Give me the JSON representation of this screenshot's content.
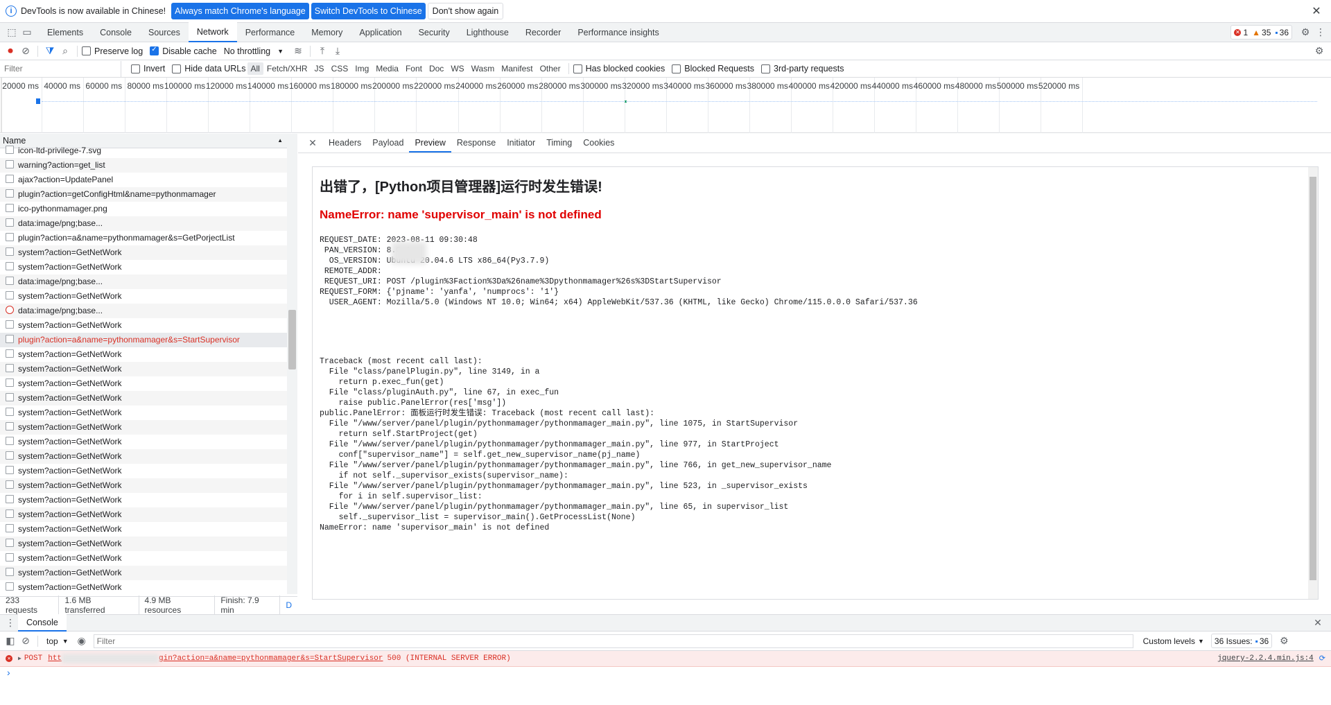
{
  "infobar": {
    "message": "DevTools is now available in Chinese!",
    "btn_match": "Always match Chrome's language",
    "btn_switch": "Switch DevTools to Chinese",
    "btn_dont": "Don't show again"
  },
  "tabs": [
    "Elements",
    "Console",
    "Sources",
    "Network",
    "Performance",
    "Memory",
    "Application",
    "Security",
    "Lighthouse",
    "Recorder",
    "Performance insights"
  ],
  "counts": {
    "errors": "1",
    "warnings": "35",
    "messages": "36"
  },
  "toolbar": {
    "preserve_log": "Preserve log",
    "disable_cache": "Disable cache",
    "throttling": "No throttling"
  },
  "filterbar": {
    "placeholder": "Filter",
    "invert": "Invert",
    "hide_data_urls": "Hide data URLs",
    "types": [
      "All",
      "Fetch/XHR",
      "JS",
      "CSS",
      "Img",
      "Media",
      "Font",
      "Doc",
      "WS",
      "Wasm",
      "Manifest",
      "Other"
    ],
    "blocked_cookies": "Has blocked cookies",
    "blocked_requests": "Blocked Requests",
    "third_party": "3rd-party requests"
  },
  "overview_ticks": [
    "20000 ms",
    "40000 ms",
    "60000 ms",
    "80000 ms",
    "100000 ms",
    "120000 ms",
    "140000 ms",
    "160000 ms",
    "180000 ms",
    "200000 ms",
    "220000 ms",
    "240000 ms",
    "260000 ms",
    "280000 ms",
    "300000 ms",
    "320000 ms",
    "340000 ms",
    "360000 ms",
    "380000 ms",
    "400000 ms",
    "420000 ms",
    "440000 ms",
    "460000 ms",
    "480000 ms",
    "500000 ms",
    "520000 ms"
  ],
  "requests": {
    "header": "Name",
    "rows": [
      "icon-ltd-privilege-7.svg",
      "warning?action=get_list",
      "ajax?action=UpdatePanel",
      "plugin?action=getConfigHtml&name=pythonmamager",
      "ico-pythonmamager.png",
      "data:image/png;base...",
      "plugin?action=a&name=pythonmamager&s=GetPorjectList",
      "system?action=GetNetWork",
      "system?action=GetNetWork",
      "data:image/png;base...",
      "system?action=GetNetWork",
      "data:image/png;base...",
      "system?action=GetNetWork",
      "plugin?action=a&name=pythonmamager&s=StartSupervisor",
      "system?action=GetNetWork",
      "system?action=GetNetWork",
      "system?action=GetNetWork",
      "system?action=GetNetWork",
      "system?action=GetNetWork",
      "system?action=GetNetWork",
      "system?action=GetNetWork",
      "system?action=GetNetWork",
      "system?action=GetNetWork",
      "system?action=GetNetWork",
      "system?action=GetNetWork",
      "system?action=GetNetWork",
      "system?action=GetNetWork",
      "system?action=GetNetWork",
      "system?action=GetNetWork",
      "system?action=GetNetWork",
      "system?action=GetNetWork"
    ]
  },
  "detail_tabs": [
    "Headers",
    "Payload",
    "Preview",
    "Response",
    "Initiator",
    "Timing",
    "Cookies"
  ],
  "preview": {
    "title": "出错了，[Python项目管理器]运行时发生错误!",
    "error": "NameError: name 'supervisor_main' is not defined",
    "request_lines": [
      "REQUEST_DATE: 2023-08-11 09:30:48",
      " PAN_VERSION: 8.0.1",
      "  OS_VERSION: Ubuntu 20.04.6 LTS x86_64(Py3.7.9)",
      " REMOTE_ADDR:",
      " REQUEST_URI: POST /plugin%3Faction%3Da%26name%3Dpythonmamager%26s%3DStartSupervisor",
      "REQUEST_FORM: {'pjname': 'yanfa', 'numprocs': '1'}",
      "  USER_AGENT: Mozilla/5.0 (Windows NT 10.0; Win64; x64) AppleWebKit/537.36 (KHTML, like Gecko) Chrome/115.0.0.0 Safari/537.36"
    ],
    "traceback_lines": [
      "Traceback (most recent call last):",
      "  File \"class/panelPlugin.py\", line 3149, in a",
      "    return p.exec_fun(get)",
      "  File \"class/pluginAuth.py\", line 67, in exec_fun",
      "    raise public.PanelError(res['msg'])",
      "public.PanelError: 面板运行时发生错误: Traceback (most recent call last):",
      "  File \"/www/server/panel/plugin/pythonmamager/pythonmamager_main.py\", line 1075, in StartSupervisor",
      "    return self.StartProject(get)",
      "  File \"/www/server/panel/plugin/pythonmamager/pythonmamager_main.py\", line 977, in StartProject",
      "    conf[\"supervisor_name\"] = self.get_new_supervisor_name(pj_name)",
      "  File \"/www/server/panel/plugin/pythonmamager/pythonmamager_main.py\", line 766, in get_new_supervisor_name",
      "    if not self._supervisor_exists(supervisor_name):",
      "  File \"/www/server/panel/plugin/pythonmamager/pythonmamager_main.py\", line 523, in _supervisor_exists",
      "    for i in self.supervisor_list:",
      "  File \"/www/server/panel/plugin/pythonmamager/pythonmamager_main.py\", line 65, in supervisor_list",
      "    self._supervisor_list = supervisor_main().GetProcessList(None)",
      "NameError: name 'supervisor_main' is not defined"
    ]
  },
  "status": {
    "requests": "233 requests",
    "transferred": "1.6 MB transferred",
    "resources": "4.9 MB resources",
    "finish": "Finish: 7.9 min",
    "extra": "D"
  },
  "drawer": {
    "tab": "Console",
    "context": "top",
    "filter_placeholder": "Filter",
    "levels": "Custom levels",
    "issues_label": "36 Issues:",
    "issues_count": "36"
  },
  "console_message": {
    "method": "POST",
    "url_start": "htt",
    "url_end": "gin?action=a&name=pythonmamager&s=StartSupervisor",
    "status": "500 (INTERNAL SERVER ERROR)",
    "source": "jquery-2.2.4.min.js:4"
  },
  "colors": {
    "accent": "#1a73e8",
    "error": "#d93025",
    "preview_error": "#e00000"
  }
}
